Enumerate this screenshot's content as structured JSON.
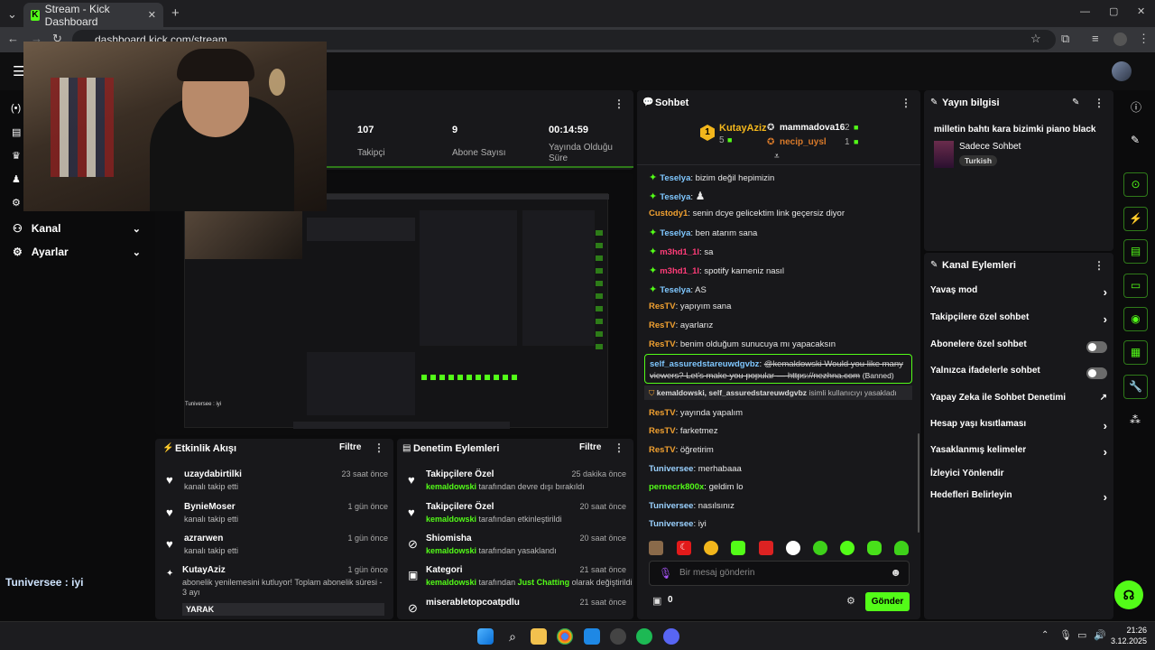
{
  "browser": {
    "tab_title": "Stream - Kick Dashboard",
    "tab_favicon": "K",
    "url": "dashboard.kick.com/stream"
  },
  "sidebar": {
    "items": [
      {
        "label": "Kanal"
      },
      {
        "label": "Ayarlar"
      }
    ]
  },
  "overlay_caption": "Tuniversee : iyi",
  "stats": [
    {
      "value": "107",
      "label": "Takipçi"
    },
    {
      "value": "9",
      "label": "Abone Sayısı"
    },
    {
      "value": "00:14:59",
      "label": "Yayında Olduğu Süre"
    }
  ],
  "preview": {
    "caption": "Tuniversee : iyi"
  },
  "activity_feed": {
    "title": "Etkinlik Akışı",
    "filter_label": "Filtre",
    "rows": [
      {
        "name": "uzaydabirtilki",
        "sub": "kanalı takip etti",
        "time": "23 saat önce"
      },
      {
        "name": "BynieMoser",
        "sub": "kanalı takip etti",
        "time": "1 gün önce"
      },
      {
        "name": "azrarwen",
        "sub": "kanalı takip etti",
        "time": "1 gün önce"
      },
      {
        "name": "KutayAziz",
        "sub": "abonelik yenilemesini kutluyor! Toplam abonelik süresi - 3 ayı",
        "time": "1 gün önce"
      }
    ],
    "bottom_label": "YARAK"
  },
  "moderation": {
    "title": "Denetim Eylemleri",
    "filter_label": "Filtre",
    "rows": [
      {
        "name": "Takipçilere Özel",
        "actor": "kemaldowski",
        "action": "tarafından devre dışı bırakıldı",
        "time": "25 dakika önce"
      },
      {
        "name": "Takipçilere Özel",
        "actor": "kemaldowski",
        "action": "tarafından etkinleştirildi",
        "time": "20 saat önce"
      },
      {
        "name": "Shiomisha",
        "actor": "kemaldowski",
        "action": "tarafından yasaklandı",
        "time": "20 saat önce"
      },
      {
        "name": "Kategori",
        "actor": "kemaldowski",
        "action": "tarafından",
        "extra": "Just Chatting",
        "action2": "olarak değiştirildi",
        "time": "21 saat önce"
      },
      {
        "name": "miserabletopcoatpdlu",
        "actor": "",
        "action": "",
        "time": "21 saat önce"
      }
    ]
  },
  "chat": {
    "title": "Sohbet",
    "leaderboard": [
      {
        "rank": "1",
        "name": "KutayAziz",
        "count": "5"
      },
      {
        "rank": "",
        "name": "mammadova16",
        "count": "2"
      },
      {
        "rank": "",
        "name": "necip_uysl",
        "count": "1"
      }
    ],
    "messages": [
      {
        "user": "Teselya",
        "text": "bizim değil hepimizin",
        "color": "teal",
        "badge": true
      },
      {
        "user": "Teselya",
        "text": "",
        "color": "teal",
        "badge": true,
        "emote": true
      },
      {
        "user": "Custody1",
        "text": "senin dcye gelicektim link geçersiz diyor",
        "color": "orange",
        "badge": false
      },
      {
        "user": "Teselya",
        "text": "ben atarım sana",
        "color": "teal",
        "badge": true
      },
      {
        "user": "m3hd1_1l",
        "text": "sa",
        "color": "pink",
        "badge": true
      },
      {
        "user": "m3hd1_1l",
        "text": "spotify karneniz nasıl",
        "color": "pink",
        "badge": true
      },
      {
        "user": "Teselya",
        "text": "AS",
        "color": "teal",
        "badge": true
      },
      {
        "user": "ResTV",
        "text": "yapıyım sana",
        "color": "orange",
        "badge": false
      },
      {
        "user": "ResTV",
        "text": "ayarlarız",
        "color": "orange",
        "badge": false
      },
      {
        "user": "ResTV",
        "text": "benim olduğum sunucuya mı yapacaksın",
        "color": "orange",
        "badge": false
      }
    ],
    "banned_message": {
      "user": "self_assuredstareuwdgvbz",
      "text": "@kemaldowski Would you like many viewers? Let's make you popular — https://nezhna.com",
      "tag": "(Banned)"
    },
    "ban_notice": {
      "users": "kemaldowski, self_assuredstareuwdgvbz",
      "text": "isimli kullanıcıyı yasakladı"
    },
    "messages2": [
      {
        "user": "ResTV",
        "text": "yayında yapalım",
        "color": "orange"
      },
      {
        "user": "ResTV",
        "text": "farketmez",
        "color": "orange"
      },
      {
        "user": "ResTV",
        "text": "öğretirim",
        "color": "orange"
      },
      {
        "user": "Tuniversee",
        "text": "merhabaaa",
        "color": "lightblue"
      },
      {
        "user": "pernecrk800x",
        "text": "geldim lo",
        "color": "green"
      },
      {
        "user": "Tuniversee",
        "text": "nasılsınız",
        "color": "lightblue"
      },
      {
        "user": "Tuniversee",
        "text": "iyi",
        "color": "lightblue"
      }
    ],
    "input_placeholder": "Bir mesaj gönderin",
    "points": "0",
    "send_label": "Gönder"
  },
  "stream_info": {
    "title": "Yayın bilgisi",
    "stream_title": "milletin bahtı kara bizimki piano black",
    "category": "Sadece Sohbet",
    "tag": "Turkish"
  },
  "channel_actions": {
    "title": "Kanal Eylemleri",
    "items": [
      {
        "label": "Yavaş mod",
        "control": "chevron"
      },
      {
        "label": "Takipçilere özel sohbet",
        "control": "chevron"
      },
      {
        "label": "Abonelere özel sohbet",
        "control": "toggle"
      },
      {
        "label": "Yalnızca ifadelerle sohbet",
        "control": "toggle"
      },
      {
        "label": "Yapay Zeka ile Sohbet Denetimi",
        "control": "external"
      },
      {
        "label": "Hesap yaşı kısıtlaması",
        "control": "chevron"
      },
      {
        "label": "Yasaklanmış kelimeler",
        "control": "chevron"
      },
      {
        "label": "İzleyici Yönlendir",
        "control": "none"
      },
      {
        "label": "Hedefleri Belirleyin",
        "control": "chevron"
      }
    ]
  },
  "taskbar": {
    "time": "21:26",
    "date": "3.12.2025"
  },
  "colors": {
    "accent": "#53fc18",
    "panel": "#18181b",
    "background": "#0b0b0c"
  }
}
